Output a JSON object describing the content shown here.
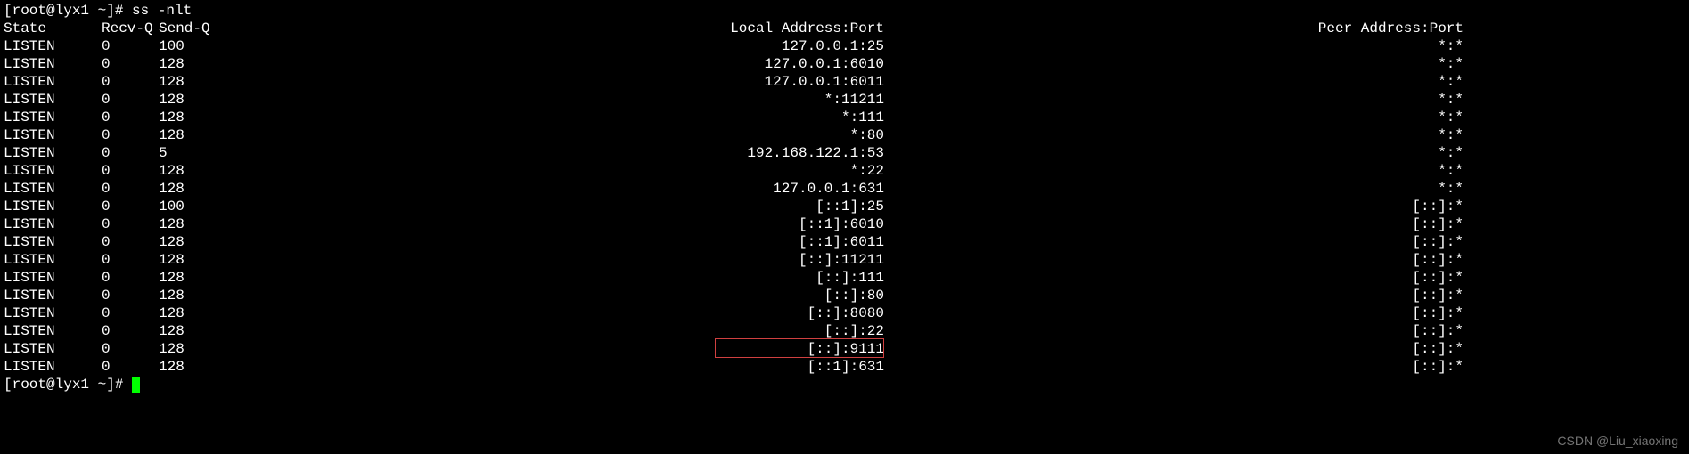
{
  "prompt1": "[root@lyx1 ~]# ss -nlt",
  "prompt2": "[root@lyx1 ~]# ",
  "headers": {
    "state": "State",
    "recvq": "Recv-Q",
    "sendq": "Send-Q",
    "local": "Local Address:Port",
    "peer": "Peer Address:Port"
  },
  "rows": [
    {
      "state": "LISTEN",
      "recvq": "0",
      "sendq": "100",
      "local": "127.0.0.1:25",
      "peer": "*:*"
    },
    {
      "state": "LISTEN",
      "recvq": "0",
      "sendq": "128",
      "local": "127.0.0.1:6010",
      "peer": "*:*"
    },
    {
      "state": "LISTEN",
      "recvq": "0",
      "sendq": "128",
      "local": "127.0.0.1:6011",
      "peer": "*:*"
    },
    {
      "state": "LISTEN",
      "recvq": "0",
      "sendq": "128",
      "local": "*:11211",
      "peer": "*:*"
    },
    {
      "state": "LISTEN",
      "recvq": "0",
      "sendq": "128",
      "local": "*:111",
      "peer": "*:*"
    },
    {
      "state": "LISTEN",
      "recvq": "0",
      "sendq": "128",
      "local": "*:80",
      "peer": "*:*"
    },
    {
      "state": "LISTEN",
      "recvq": "0",
      "sendq": "5",
      "local": "192.168.122.1:53",
      "peer": "*:*"
    },
    {
      "state": "LISTEN",
      "recvq": "0",
      "sendq": "128",
      "local": "*:22",
      "peer": "*:*"
    },
    {
      "state": "LISTEN",
      "recvq": "0",
      "sendq": "128",
      "local": "127.0.0.1:631",
      "peer": "*:*"
    },
    {
      "state": "LISTEN",
      "recvq": "0",
      "sendq": "100",
      "local": "[::1]:25",
      "peer": "[::]:*"
    },
    {
      "state": "LISTEN",
      "recvq": "0",
      "sendq": "128",
      "local": "[::1]:6010",
      "peer": "[::]:*"
    },
    {
      "state": "LISTEN",
      "recvq": "0",
      "sendq": "128",
      "local": "[::1]:6011",
      "peer": "[::]:*"
    },
    {
      "state": "LISTEN",
      "recvq": "0",
      "sendq": "128",
      "local": "[::]:11211",
      "peer": "[::]:*"
    },
    {
      "state": "LISTEN",
      "recvq": "0",
      "sendq": "128",
      "local": "[::]:111",
      "peer": "[::]:*"
    },
    {
      "state": "LISTEN",
      "recvq": "0",
      "sendq": "128",
      "local": "[::]:80",
      "peer": "[::]:*"
    },
    {
      "state": "LISTEN",
      "recvq": "0",
      "sendq": "128",
      "local": "[::]:8080",
      "peer": "[::]:*"
    },
    {
      "state": "LISTEN",
      "recvq": "0",
      "sendq": "128",
      "local": "[::]:22",
      "peer": "[::]:*"
    },
    {
      "state": "LISTEN",
      "recvq": "0",
      "sendq": "128",
      "local": "[::]:9111",
      "peer": "[::]:*",
      "highlight": true
    },
    {
      "state": "LISTEN",
      "recvq": "0",
      "sendq": "128",
      "local": "[::1]:631",
      "peer": "[::]:*"
    }
  ],
  "watermark": "CSDN @Liu_xiaoxing"
}
